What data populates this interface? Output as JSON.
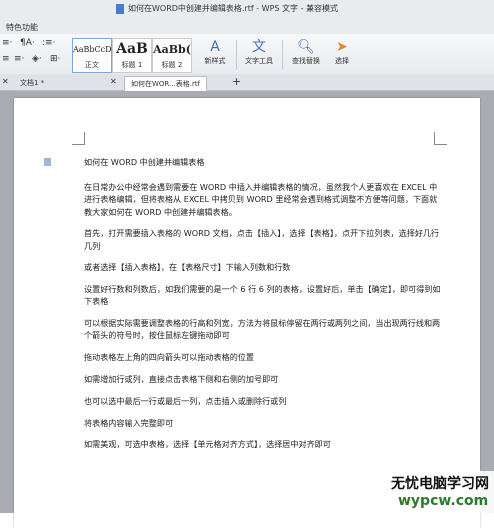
{
  "window": {
    "title": "如何在WORD中创建并编辑表格.rtf - WPS 文字 - 兼容模式"
  },
  "menubar": {
    "label": "特色功能"
  },
  "ribbon": {
    "styles": [
      {
        "preview": "AaBbCcD",
        "label": "正文"
      },
      {
        "preview": "AaB",
        "label": "标题 1"
      },
      {
        "preview": "AaBb(",
        "label": "标题 2"
      }
    ],
    "new_style": "新样式",
    "text_tools": "文字工具",
    "find_replace": "查找替换",
    "select": "选择"
  },
  "tabs": [
    {
      "label": "文档1 *"
    },
    {
      "label": "如何在WOR...表格.rtf"
    }
  ],
  "document": {
    "paragraphs": [
      "如何在 WORD 中创建并编辑表格",
      "在日常办公中经常会遇到需要在 WORD 中插入并编辑表格的情况，虽然我个人更喜欢在 EXCEL 中进行表格编辑，但将表格从 EXCEL 中拷贝到 WORD 里经常会遇到格式调整不方便等问题，下面就教大家如何在 WORD 中创建并编辑表格。",
      "首先，打开需要插入表格的 WORD 文档，点击【插入】，选择【表格】，点开下拉列表，选择好几行几列",
      "或者选择【插入表格】，在【表格尺寸】下输入列数和行数",
      "设置好行数和列数后，如我们需要的是一个 6 行 6 列的表格，设置好后，单击【确定】，即可得到如下表格",
      "可以根据实际需要调整表格的行高和列宽，方法为将鼠标停留在两行或两列之间，当出现两行线和两个箭头的符号时，按住鼠标左键拖动即可",
      "拖动表格左上角的四向箭头可以拖动表格的位置",
      "如需增加行或列，直接点击表格下侧和右侧的加号即可",
      "也可以选中最后一行或最后一列，点击插入或删除行或列",
      "将表格内容输入完整即可",
      "如需美观，可选中表格，选择【单元格对齐方式】，选择居中对齐即可"
    ]
  },
  "watermark": {
    "line1": "无忧电脑学习网",
    "line2": "wypcw.com"
  }
}
